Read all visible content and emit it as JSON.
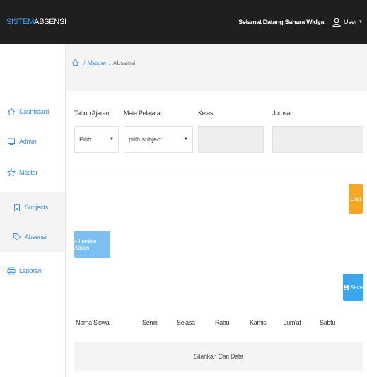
{
  "brand": {
    "part1": "SISTEM",
    "part2": "ABSENSI"
  },
  "header": {
    "welcome": "Selamat Datang Sahara Widya",
    "user_label": "User"
  },
  "sidebar": {
    "items": [
      {
        "label": "Dashboard",
        "icon": "home-icon"
      },
      {
        "label": "Admin",
        "icon": "monitor-icon"
      },
      {
        "label": "Master",
        "icon": "star-icon"
      },
      {
        "label": "Subjects",
        "icon": "clipboard-icon"
      },
      {
        "label": "Absensi",
        "icon": "tag-icon"
      },
      {
        "label": "Laporan",
        "icon": "printer-icon"
      }
    ]
  },
  "breadcrumb": {
    "items": [
      "Master",
      "Absensi"
    ]
  },
  "filters": {
    "tahun_ajaran": {
      "label": "Tahun Ajaran",
      "value": "Pilih.."
    },
    "mata_pelajaran": {
      "label": "Mata Pelajaran",
      "value": "pilih subject.."
    },
    "kelas": {
      "label": "Kelas"
    },
    "jurusan": {
      "label": "Jurusan"
    }
  },
  "buttons": {
    "cari": "Cari",
    "lembar_absen": "+ Lembar Absen",
    "save": "Save"
  },
  "table": {
    "headers": [
      "Nama Siswa",
      "Senin",
      "Selasa",
      "Rabu",
      "Kamis",
      "Jum'at",
      "Sabtu"
    ],
    "empty_text": "Silahkan Cari Data"
  },
  "colors": {
    "accent": "#3c8dde",
    "brand_blue": "#3c9bf0",
    "warning": "#f5a623",
    "info": "#3ba6ef",
    "topbar": "#1f1f1f"
  }
}
